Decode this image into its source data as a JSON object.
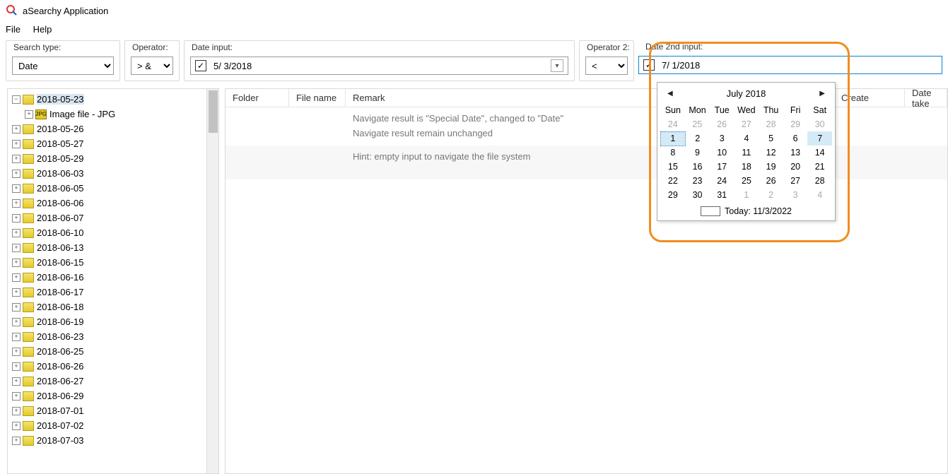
{
  "app": {
    "title": "aSearchy Application"
  },
  "menu": {
    "file": "File",
    "help": "Help"
  },
  "toolbar": {
    "searchtype_label": "Search type:",
    "searchtype_value": "Date",
    "operator_label": "Operator:",
    "operator_value": "> &",
    "dateinput_label": "Date input:",
    "dateinput_value": "5/  3/2018",
    "operator2_label": "Operator 2:",
    "operator2_value": "<",
    "date2nd_label": "Date 2nd input:",
    "date2nd_value": "7/  1/2018"
  },
  "tree": {
    "items": [
      {
        "label": "2018-05-23",
        "expanded": true,
        "selected": true
      },
      {
        "label": "Image file - JPG",
        "level": 1,
        "img": true
      },
      {
        "label": "2018-05-26"
      },
      {
        "label": "2018-05-27"
      },
      {
        "label": "2018-05-29"
      },
      {
        "label": "2018-06-03"
      },
      {
        "label": "2018-06-05"
      },
      {
        "label": "2018-06-06"
      },
      {
        "label": "2018-06-07"
      },
      {
        "label": "2018-06-10"
      },
      {
        "label": "2018-06-13"
      },
      {
        "label": "2018-06-15"
      },
      {
        "label": "2018-06-16"
      },
      {
        "label": "2018-06-17"
      },
      {
        "label": "2018-06-18"
      },
      {
        "label": "2018-06-19"
      },
      {
        "label": "2018-06-23"
      },
      {
        "label": "2018-06-25"
      },
      {
        "label": "2018-06-26"
      },
      {
        "label": "2018-06-27"
      },
      {
        "label": "2018-06-29"
      },
      {
        "label": "2018-07-01"
      },
      {
        "label": "2018-07-02"
      },
      {
        "label": "2018-07-03"
      }
    ]
  },
  "list": {
    "headers": {
      "folder": "Folder",
      "file": "File name",
      "remark": "Remark",
      "create": "Create",
      "taken": "Date take"
    },
    "rows": [
      {
        "remark": "Navigate result is \"Special Date\", changed to \"Date\"\nNavigate result remain unchanged"
      },
      {
        "remark": "Hint: empty input to navigate the file system",
        "alt": true
      }
    ]
  },
  "calendar": {
    "title": "July 2018",
    "dow": [
      "Sun",
      "Mon",
      "Tue",
      "Wed",
      "Thu",
      "Fri",
      "Sat"
    ],
    "weeks": [
      [
        {
          "d": "24",
          "o": true
        },
        {
          "d": "25",
          "o": true
        },
        {
          "d": "26",
          "o": true
        },
        {
          "d": "27",
          "o": true
        },
        {
          "d": "28",
          "o": true
        },
        {
          "d": "29",
          "o": true
        },
        {
          "d": "30",
          "o": true
        }
      ],
      [
        {
          "d": "1",
          "sel": true
        },
        {
          "d": "2"
        },
        {
          "d": "3"
        },
        {
          "d": "4"
        },
        {
          "d": "5"
        },
        {
          "d": "6"
        },
        {
          "d": "7",
          "hl": true
        }
      ],
      [
        {
          "d": "8"
        },
        {
          "d": "9"
        },
        {
          "d": "10"
        },
        {
          "d": "11"
        },
        {
          "d": "12"
        },
        {
          "d": "13"
        },
        {
          "d": "14"
        }
      ],
      [
        {
          "d": "15"
        },
        {
          "d": "16"
        },
        {
          "d": "17"
        },
        {
          "d": "18"
        },
        {
          "d": "19"
        },
        {
          "d": "20"
        },
        {
          "d": "21"
        }
      ],
      [
        {
          "d": "22"
        },
        {
          "d": "23"
        },
        {
          "d": "24"
        },
        {
          "d": "25"
        },
        {
          "d": "26"
        },
        {
          "d": "27"
        },
        {
          "d": "28"
        }
      ],
      [
        {
          "d": "29"
        },
        {
          "d": "30"
        },
        {
          "d": "31"
        },
        {
          "d": "1",
          "o": true
        },
        {
          "d": "2",
          "o": true
        },
        {
          "d": "3",
          "o": true
        },
        {
          "d": "4",
          "o": true
        }
      ]
    ],
    "today_label": "Today: 11/3/2022"
  }
}
